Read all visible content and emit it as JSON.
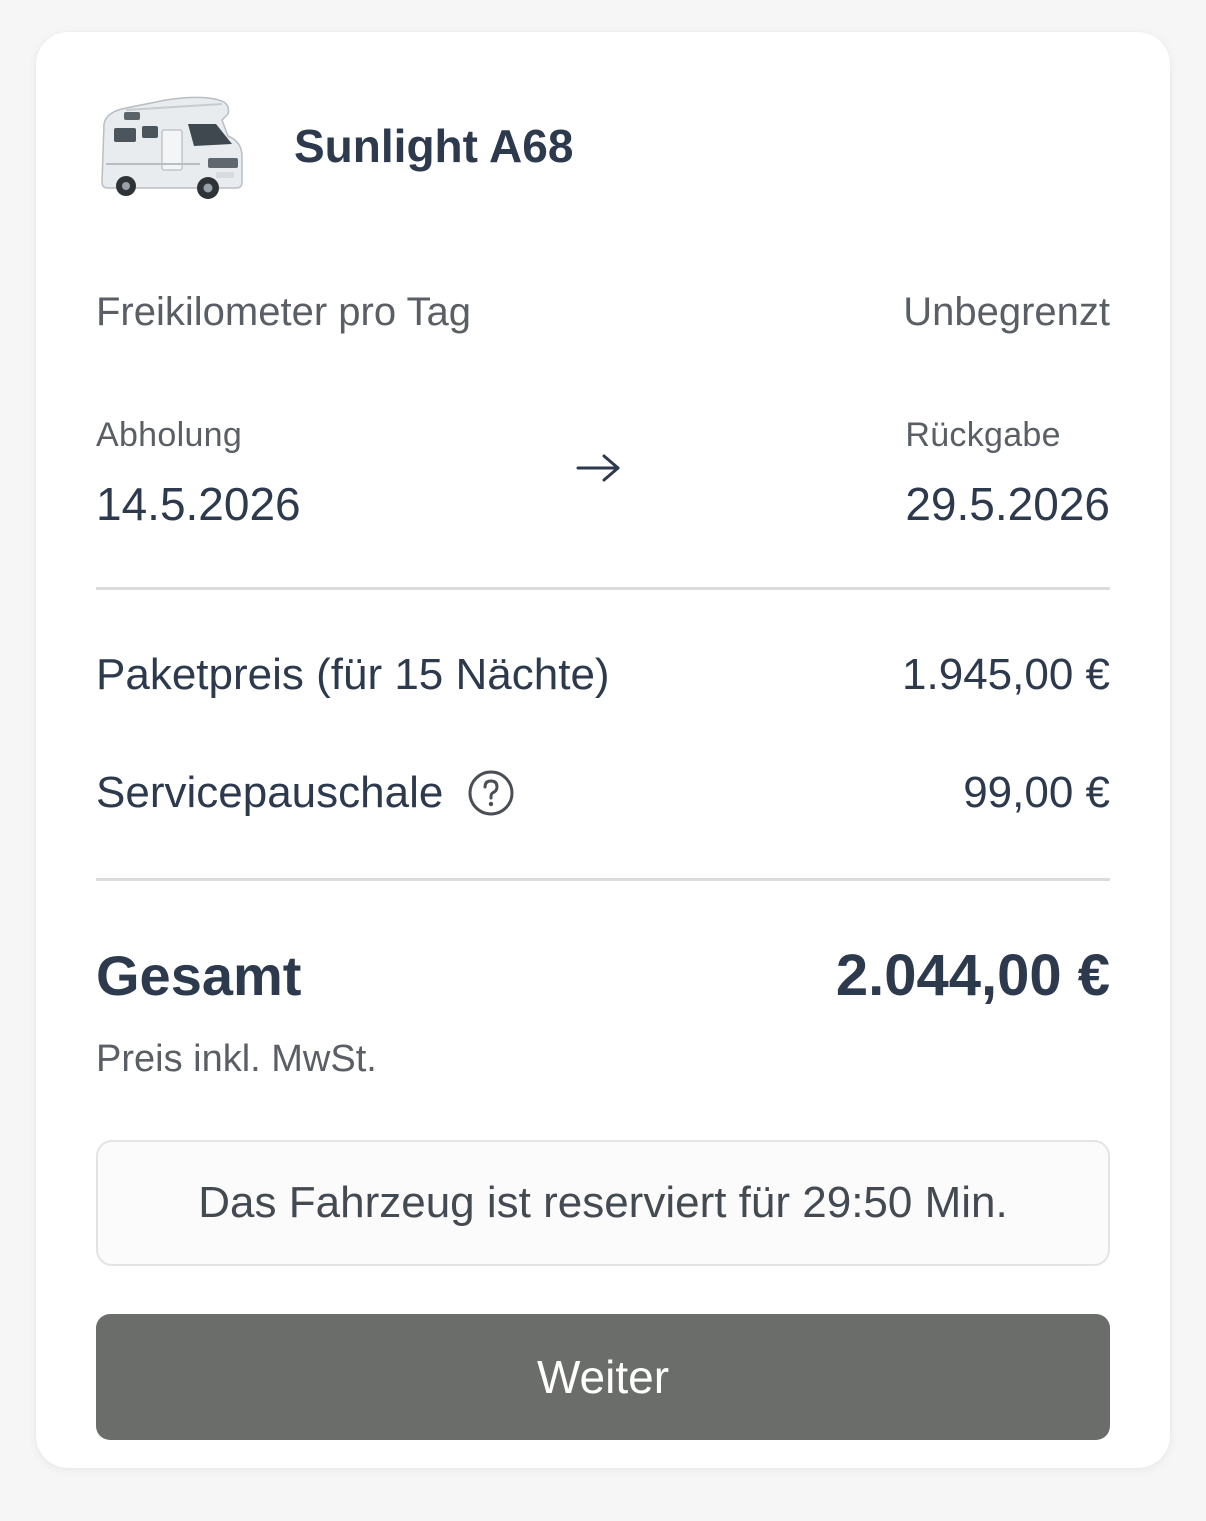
{
  "vehicle": {
    "name": "Sunlight A68",
    "image_alt": "motorhome-icon"
  },
  "free_km": {
    "label": "Freikilometer pro Tag",
    "value": "Unbegrenzt"
  },
  "dates": {
    "pickup_label": "Abholung",
    "pickup_date": "14.5.2026",
    "return_label": "Rückgabe",
    "return_date": "29.5.2026",
    "arrow_icon": "arrow-right-icon"
  },
  "prices": {
    "package_label": "Paketpreis (für 15 Nächte)",
    "package_value": "1.945,00 €",
    "service_label": "Servicepauschale",
    "service_value": "99,00 €",
    "service_icon": "help-circle-icon"
  },
  "total": {
    "label": "Gesamt",
    "value": "2.044,00 €",
    "note": "Preis inkl. MwSt."
  },
  "reservation": {
    "text": "Das Fahrzeug ist reserviert für 29:50 Min."
  },
  "actions": {
    "continue_label": "Weiter"
  },
  "colors": {
    "title": "#2d3a4e",
    "secondary_text": "#5a5f66",
    "button": "#6b6d6a",
    "background": "#f6f6f6"
  }
}
